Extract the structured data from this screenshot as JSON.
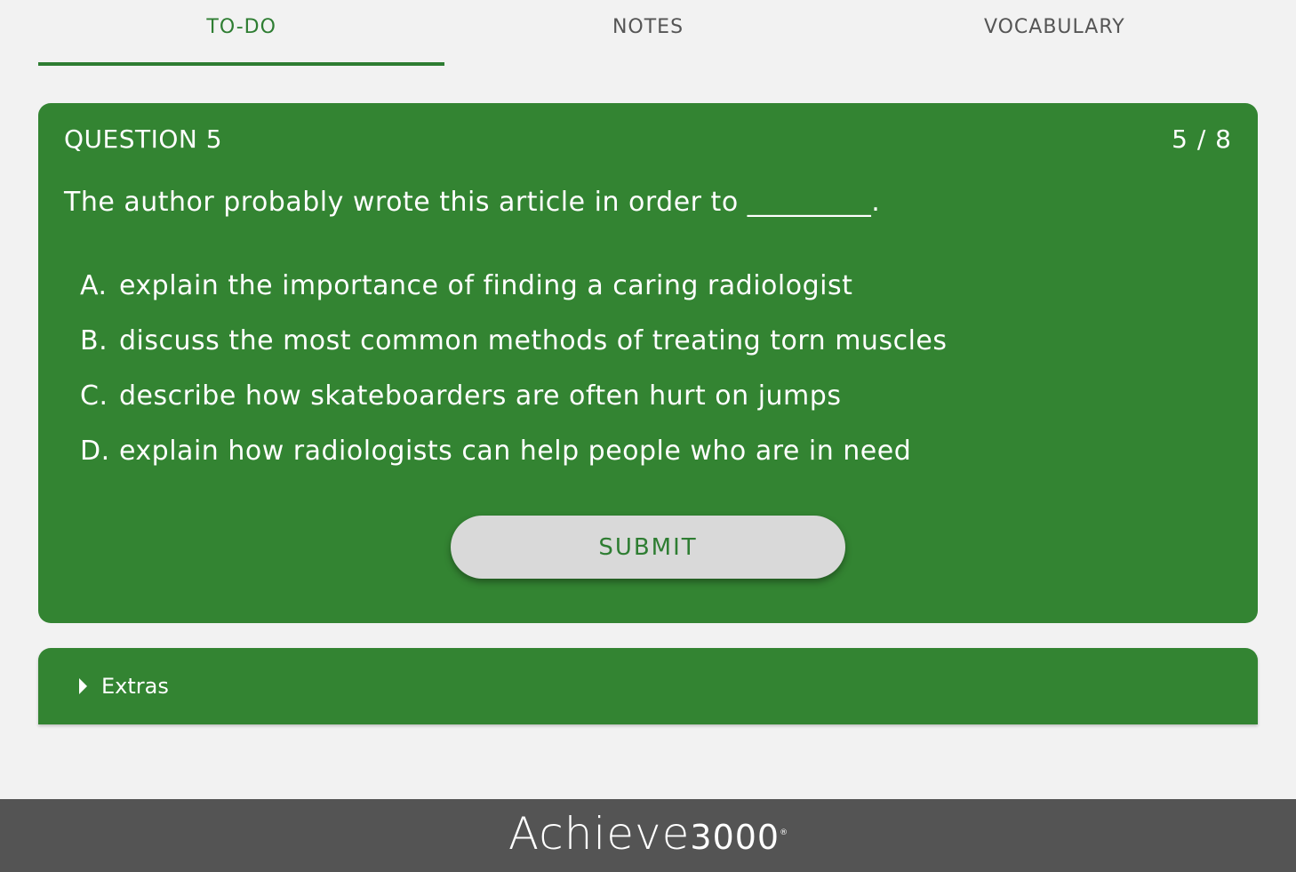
{
  "tabs": [
    {
      "label": "TO-DO",
      "active": true
    },
    {
      "label": "NOTES",
      "active": false
    },
    {
      "label": "VOCABULARY",
      "active": false
    }
  ],
  "question": {
    "title": "QUESTION 5",
    "progress": "5 / 8",
    "text": "The author probably wrote this article in order to _________.",
    "choices": [
      {
        "letter": "A.",
        "text": "explain the importance of finding a caring radiologist"
      },
      {
        "letter": "B.",
        "text": "discuss the most common methods of treating torn muscles"
      },
      {
        "letter": "C.",
        "text": "describe how skateboarders are often hurt on jumps"
      },
      {
        "letter": "D.",
        "text": "explain how radiologists can help people who are in need"
      }
    ],
    "submit_label": "SUBMIT"
  },
  "extras": {
    "label": "Extras",
    "icon": "caret-right-icon"
  },
  "footer": {
    "logo_word": "Achieve",
    "logo_number": "3000",
    "logo_mark": "®"
  },
  "colors": {
    "accent_green": "#338432",
    "tab_active": "#2e7d32",
    "footer_bg": "#545454",
    "page_bg": "#f2f2f2"
  }
}
